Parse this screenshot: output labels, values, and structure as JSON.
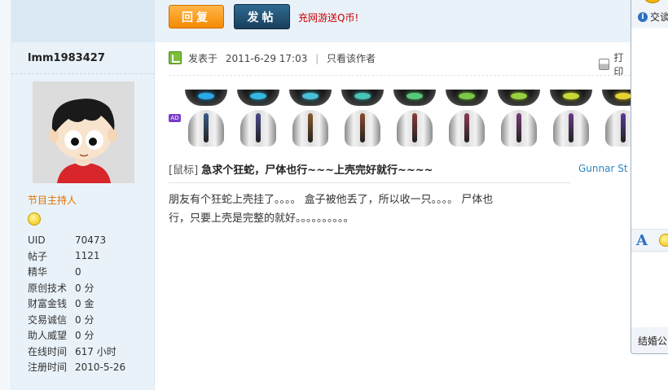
{
  "toolbar": {
    "reply_label": "回复",
    "post_label": "发帖",
    "promo_text": "充网游送Q币!"
  },
  "user": {
    "username": "lmm1983427",
    "title": "节目主持人",
    "stats": [
      {
        "label": "UID",
        "value": "70473"
      },
      {
        "label": "帖子",
        "value": "1121"
      },
      {
        "label": "精华",
        "value": "0"
      },
      {
        "label": "原创技术",
        "value": "0 分"
      },
      {
        "label": "财富金钱",
        "value": "0 金"
      },
      {
        "label": "交易诚信",
        "value": "0 分"
      },
      {
        "label": "助人威望",
        "value": "0 分"
      },
      {
        "label": "在线时间",
        "value": "617 小时"
      },
      {
        "label": "注册时间",
        "value": "2010-5-26"
      }
    ]
  },
  "post": {
    "posted_prefix": "发表于",
    "posted_time": "2011-6-29 17:03",
    "separator": "|",
    "only_author": "只看该作者",
    "print_label": "打印",
    "ad_badge": "AD",
    "category": "[鼠标]",
    "subject": "急求个狂蛇，尸体也行~~~上壳完好就行~~~~",
    "side_link": "Gunnar St",
    "body_line1": "朋友有个狂蛇上壳挂了。。。。  盒子被他丢了，所以收一只。。。。  尸体也",
    "body_line2": "行，只要上壳是完整的就好。。。。。。。。。。"
  },
  "ad_mice": [
    {
      "light": "#2aa8e8",
      "strip": "#3a5a8a"
    },
    {
      "light": "#33b8e0",
      "strip": "#4a4a8a"
    },
    {
      "light": "#4ac0d8",
      "strip": "#8a5a2a"
    },
    {
      "light": "#48c4b8",
      "strip": "#8a4a2a"
    },
    {
      "light": "#58c878",
      "strip": "#8a3a3a"
    },
    {
      "light": "#7ac848",
      "strip": "#8a3a5a"
    },
    {
      "light": "#9ad040",
      "strip": "#7a3a7a"
    },
    {
      "light": "#c8d838",
      "strip": "#6a3a8a"
    },
    {
      "light": "#e8d030",
      "strip": "#5a3a9a"
    }
  ],
  "right_panel": {
    "info_text": "交谈",
    "font_icon": "A",
    "bottom_text": "结婚公"
  }
}
